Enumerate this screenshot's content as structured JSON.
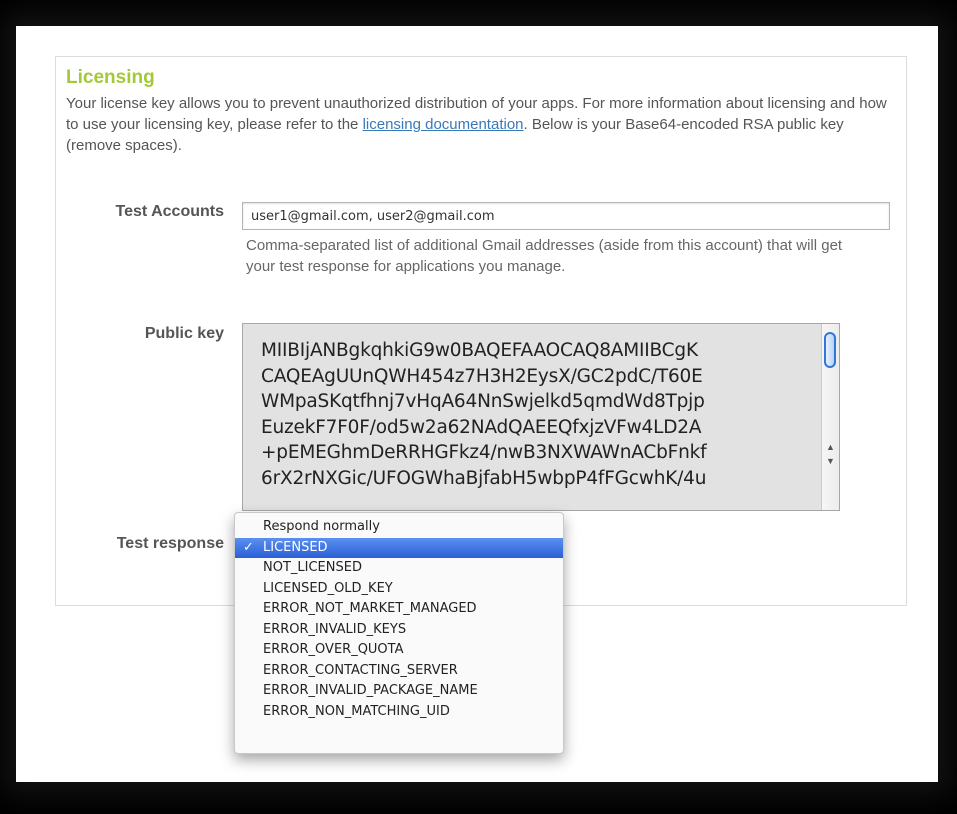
{
  "section": {
    "title": "Licensing",
    "desc_before": "Your license key allows you to prevent unauthorized distribution of your apps. For more information about licensing and how to use your licensing key, please refer to the ",
    "desc_link": "licensing documentation",
    "desc_after": ". Below is your Base64-encoded RSA public key (remove spaces)."
  },
  "test_accounts": {
    "label": "Test Accounts",
    "value": "user1@gmail.com, user2@gmail.com",
    "help": "Comma-separated list of additional Gmail addresses (aside from this account) that will get your test response for applications you manage."
  },
  "public_key": {
    "label": "Public key",
    "lines": [
      "MIIBIjANBgkqhkiG9w0BAQEFAAOCAQ8AMIIBCgK",
      "CAQEAgUUnQWH454z7H3H2EysX/GC2pdC/T60E",
      "WMpaSKqtfhnj7vHqA64NnSwjelkd5qmdWd8Tpjp",
      "EuzekF7F0F/od5w2a62NAdQAEEQfxjzVFw4LD2A",
      "+pEMEGhmDeRRHGFkz4/nwB3NXWAWnACbFnkf",
      "6rX2rNXGic/UFOGWhaBjfabH5wbpP4fFGcwhK/4u"
    ],
    "scroll_up_glyph": "▲",
    "scroll_down_glyph": "▼"
  },
  "test_response": {
    "label": "Test response",
    "selected": "LICENSED",
    "check_glyph": "✓",
    "options": [
      "Respond normally",
      "LICENSED",
      "NOT_LICENSED",
      "LICENSED_OLD_KEY",
      "ERROR_NOT_MARKET_MANAGED",
      "ERROR_INVALID_KEYS",
      "ERROR_OVER_QUOTA",
      "ERROR_CONTACTING_SERVER",
      "ERROR_INVALID_PACKAGE_NAME",
      "ERROR_NON_MATCHING_UID"
    ]
  },
  "colors": {
    "title": "#a3c93a",
    "link": "#3a79b8",
    "selection": "#2a5fd6"
  }
}
